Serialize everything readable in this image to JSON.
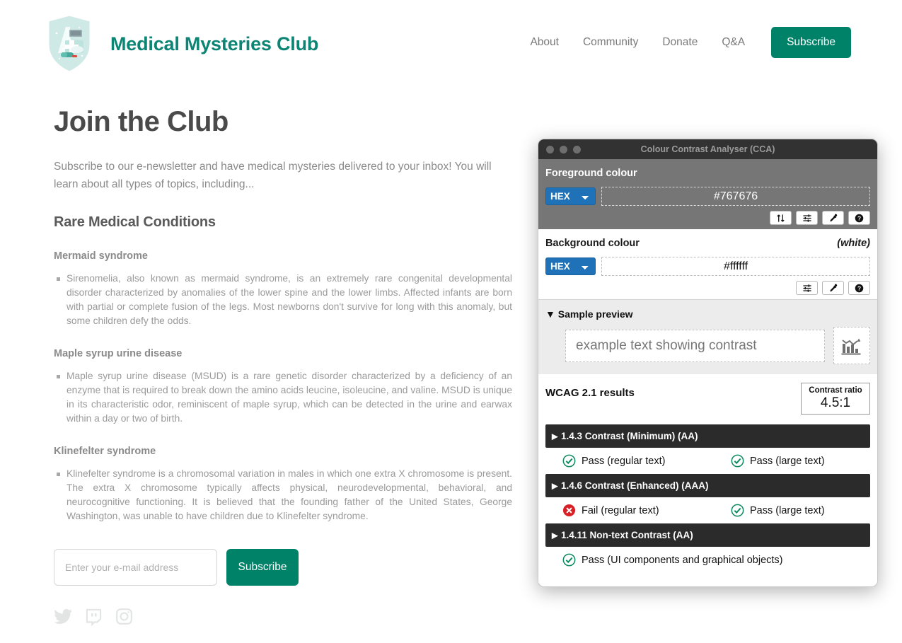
{
  "header": {
    "brand_title": "Medical Mysteries Club",
    "logo_icon": "medical-shield-logo-icon",
    "nav": [
      {
        "label": "About",
        "name": "nav-about"
      },
      {
        "label": "Community",
        "name": "nav-community"
      },
      {
        "label": "Donate",
        "name": "nav-donate"
      },
      {
        "label": "Q&A",
        "name": "nav-qa"
      }
    ],
    "subscribe_button": "Subscribe",
    "accent_color": "#008269",
    "brand_color": "#0d8575"
  },
  "main": {
    "page_title": "Join the Club",
    "intro": "Subscribe to our e-newsletter and have medical mysteries delivered to your inbox! You will learn about all types of topics, including...",
    "section_heading": "Rare Medical Conditions",
    "conditions": [
      {
        "heading": "Mermaid syndrome",
        "body": "Sirenomelia, also known as mermaid syndrome, is an extremely rare congenital developmental disorder characterized by anomalies of the lower spine and the lower limbs. Affected infants are born with partial or complete fusion of the legs. Most newborns don't survive for long with this anomaly, but some children defy the odds."
      },
      {
        "heading": "Maple syrup urine disease",
        "body": "Maple syrup urine disease (MSUD) is a rare genetic disorder characterized by a deficiency of an enzyme that is required to break down the amino acids leucine, isoleucine, and valine. MSUD is unique in its characteristic odor, reminiscent of maple syrup, which can be detected in the urine and earwax within a day or two of birth."
      },
      {
        "heading": "Klinefelter syndrome",
        "body": "Klinefelter syndrome is a chromosomal variation in males in which one extra X chromosome is present. The extra X chromosome typically affects physical, neurodevelopmental, behavioral, and neurocognitive functioning. It is believed that the founding father of the United States, George Washington, was unable to have children due to Klinefelter syndrome."
      }
    ],
    "email_placeholder": "Enter your e-mail address",
    "email_value": "",
    "subscribe_button": "Subscribe",
    "social": [
      {
        "name": "twitter-icon",
        "label": "Twitter"
      },
      {
        "name": "twitch-icon",
        "label": "Twitch"
      },
      {
        "name": "instagram-icon",
        "label": "Instagram"
      }
    ]
  },
  "cca": {
    "window_title": "Colour Contrast Analyser (CCA)",
    "foreground": {
      "label": "Foreground colour",
      "format": "HEX",
      "value": "#767676",
      "swatch_color": "#767676",
      "icons": [
        {
          "name": "swap-colours-icon",
          "glyph": "arrows-up-down"
        },
        {
          "name": "colour-sliders-icon",
          "glyph": "sliders"
        },
        {
          "name": "eyedropper-icon",
          "glyph": "eyedropper"
        },
        {
          "name": "help-icon",
          "glyph": "question"
        }
      ]
    },
    "background": {
      "label": "Background colour",
      "note": "(white)",
      "format": "HEX",
      "value": "#ffffff",
      "icons": [
        {
          "name": "colour-sliders-icon",
          "glyph": "sliders"
        },
        {
          "name": "eyedropper-icon",
          "glyph": "eyedropper"
        },
        {
          "name": "help-icon",
          "glyph": "question"
        }
      ]
    },
    "preview": {
      "disclosure": "▼ Sample preview",
      "title": "Sample preview",
      "sample_text": "example text showing contrast",
      "sample_graphic_icon": "bar-chart-declining-icon"
    },
    "results": {
      "title": "WCAG 2.1 results",
      "ratio_label": "Contrast ratio",
      "ratio_value": "4.5:1",
      "criteria": [
        {
          "title": "1.4.3 Contrast (Minimum) (AA)",
          "items": [
            {
              "status": "pass",
              "label": "Pass (regular text)"
            },
            {
              "status": "pass",
              "label": "Pass (large text)"
            }
          ]
        },
        {
          "title": "1.4.6 Contrast (Enhanced) (AAA)",
          "items": [
            {
              "status": "fail",
              "label": "Fail (regular text)"
            },
            {
              "status": "pass",
              "label": "Pass (large text)"
            }
          ]
        },
        {
          "title": "1.4.11 Non-text Contrast (AA)",
          "items": [
            {
              "status": "pass",
              "label": "Pass (UI components and graphical objects)"
            }
          ]
        }
      ],
      "pass_color": "#0f8a5f",
      "fail_color": "#d81f26"
    }
  }
}
